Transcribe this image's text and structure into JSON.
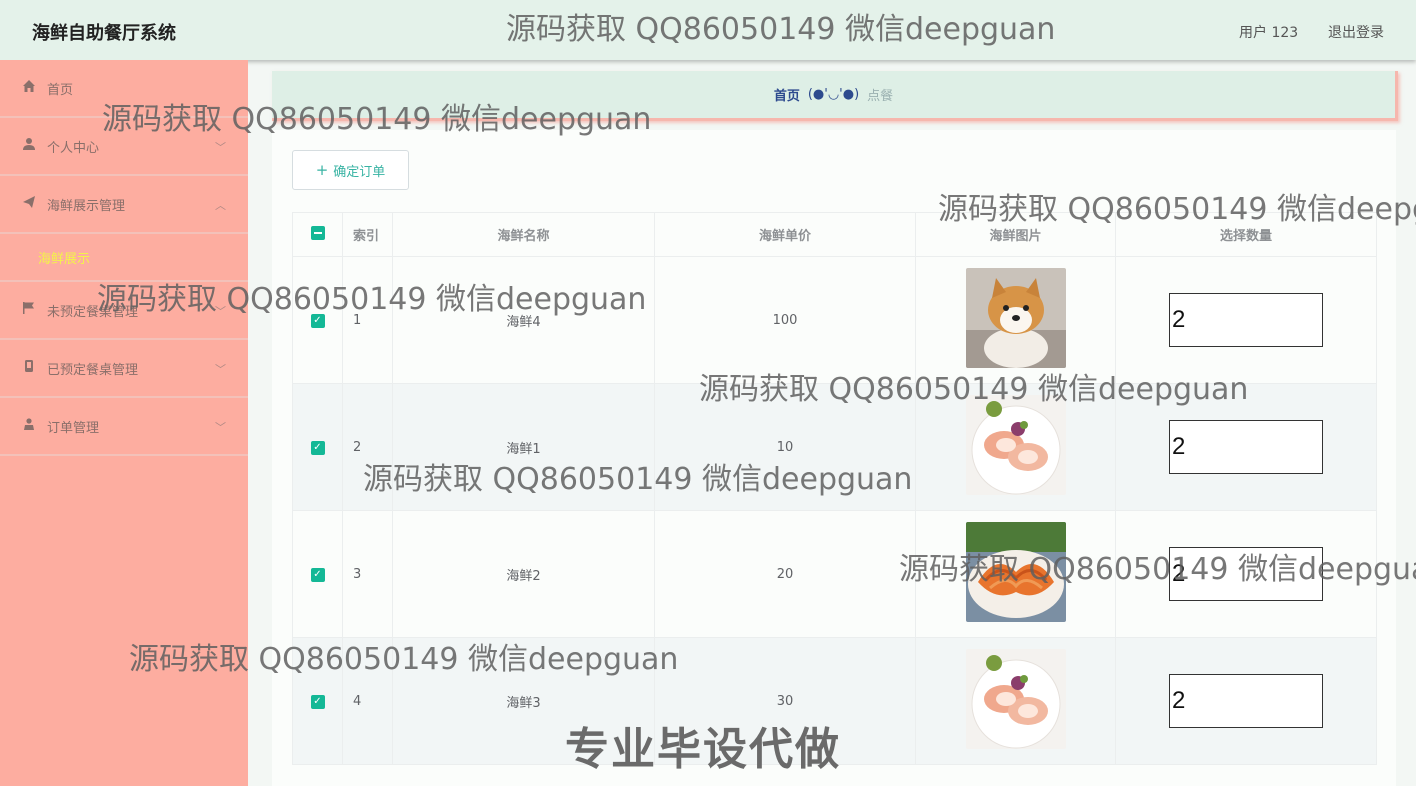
{
  "header": {
    "app_title": "海鲜自助餐厅系统",
    "user_label": "用户 123",
    "logout_label": "退出登录"
  },
  "sidebar": {
    "items": [
      {
        "label": "首页",
        "icon": "home-icon"
      },
      {
        "label": "个人中心",
        "icon": "user-icon"
      },
      {
        "label": "海鲜展示管理",
        "icon": "send-icon"
      },
      {
        "label": "未预定餐桌管理",
        "icon": "flag-icon"
      },
      {
        "label": "已预定餐桌管理",
        "icon": "phone-icon"
      },
      {
        "label": "订单管理",
        "icon": "person-icon"
      }
    ],
    "submenu_active": "海鲜展示"
  },
  "breadcrumb": {
    "home": "首页",
    "face": "(●'◡'●)",
    "current": "点餐"
  },
  "toolbar": {
    "confirm_label": "确定订单"
  },
  "table": {
    "columns": [
      "索引",
      "海鲜名称",
      "海鲜单价",
      "海鲜图片",
      "选择数量"
    ],
    "rows": [
      {
        "index": "1",
        "name": "海鲜4",
        "price": "100",
        "image": "shiba-dog-photo",
        "qty": "2"
      },
      {
        "index": "2",
        "name": "海鲜1",
        "price": "10",
        "image": "scallop-plate-photo",
        "qty": "2"
      },
      {
        "index": "3",
        "name": "海鲜2",
        "price": "20",
        "image": "shrimp-plate-photo",
        "qty": "2"
      },
      {
        "index": "4",
        "name": "海鲜3",
        "price": "30",
        "image": "scallop-plate-photo",
        "qty": "2"
      }
    ]
  },
  "watermarks": {
    "text": "源码获取 QQ86050149 微信deepguan",
    "cut1": "源码获取 QQ86050149 微信deepg",
    "cut2": "源码获取 QQ86050149 微信deepgua",
    "banner": "专业毕设代做"
  },
  "colors": {
    "sidebar": "#fdada0",
    "header": "#e4f2ea",
    "accent": "#14b896",
    "submenu_active": "#f3f34a"
  }
}
